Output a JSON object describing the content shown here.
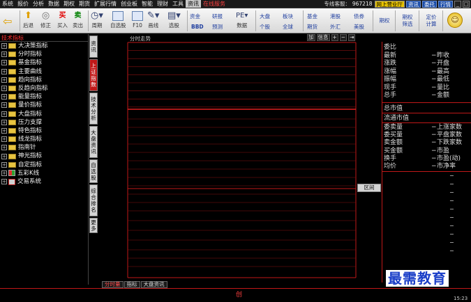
{
  "menubar": {
    "items": [
      "系统",
      "报价",
      "分析",
      "数据",
      "期权",
      "期货",
      "扩展行情",
      "创业板",
      "智能",
      "理财",
      "工具",
      "资讯",
      "在线服务"
    ],
    "hotline_label": "专线客服：",
    "hotline_number": "967218",
    "buttons": [
      "网上营业厅",
      "资讯",
      "委托",
      "行情"
    ]
  },
  "toolbar": {
    "back": "后退",
    "fav": "修正",
    "buy": "买入",
    "sell": "卖出",
    "period": "周期",
    "self_stock": "自选股",
    "f10": "F10",
    "draw": "画线",
    "select_stock": "选股",
    "capital": "资金",
    "bbd": "BBD",
    "research": "研报",
    "forecast": "预测",
    "data": "数据",
    "big_market": "大盘",
    "sector": "板块",
    "individual": "个股",
    "global": "全球",
    "fund": "基金",
    "futures": "期货",
    "hk": "港股",
    "forex": "外汇",
    "bond": "债券",
    "us": "美股",
    "options": "期权",
    "options_select": "期权\n筛选",
    "fixed_calc": "定价\n计算"
  },
  "tree": {
    "header": "技术指标",
    "items": [
      {
        "label": "大决策指标",
        "icon": "folder-icon"
      },
      {
        "label": "分时指标",
        "icon": "folder-icon"
      },
      {
        "label": "基金指标",
        "icon": "folder-icon"
      },
      {
        "label": "主要曲线",
        "icon": "folder-icon"
      },
      {
        "label": "趋向指标",
        "icon": "folder-icon"
      },
      {
        "label": "反趋向指标",
        "icon": "folder-icon"
      },
      {
        "label": "能量指标",
        "icon": "folder-icon"
      },
      {
        "label": "量价指标",
        "icon": "folder-icon"
      },
      {
        "label": "大盘指标",
        "icon": "folder-icon"
      },
      {
        "label": "压力支撑",
        "icon": "folder-icon"
      },
      {
        "label": "特色指标",
        "icon": "folder-icon"
      },
      {
        "label": "线龙指标",
        "icon": "folder-icon"
      },
      {
        "label": "指南针",
        "icon": "folder-icon"
      },
      {
        "label": "神光指标",
        "icon": "folder-icon"
      },
      {
        "label": "自定指标",
        "icon": "folder-icon"
      },
      {
        "label": "五彩K线",
        "icon": "colorful-k-icon"
      },
      {
        "label": "交易系统",
        "icon": "trade-system-icon"
      }
    ]
  },
  "vtabs": [
    "资讯",
    "上证指数",
    "技术分析",
    "大盘资讯",
    "自选股",
    "综合排名",
    "更多"
  ],
  "chart": {
    "title": "分时走势",
    "controls": [
      "加",
      "信息",
      "+",
      "−",
      "⇥"
    ],
    "range_button": "区间"
  },
  "quote": {
    "rows1": [
      [
        "委比",
        ""
      ],
      [
        "最新",
        "昨收"
      ],
      [
        "涨跌",
        "开盘"
      ],
      [
        "涨幅",
        "最高"
      ],
      [
        "振幅",
        "最低"
      ],
      [
        "现手",
        "量比"
      ],
      [
        "总手",
        "金额"
      ]
    ],
    "market_cap": "总市值",
    "float_cap": "流通市值",
    "rows2": [
      [
        "委卖量",
        "上涨家数"
      ],
      [
        "委买量",
        "平盘家数"
      ],
      [
        "卖金额",
        "下跌家数"
      ],
      [
        "买金额",
        "市盈"
      ],
      [
        "换手",
        "市盈(动)"
      ],
      [
        "均价",
        "市净率"
      ]
    ]
  },
  "bottom_tabs": [
    "分时量",
    "指标",
    "大盘资讯"
  ],
  "status": {
    "chuang": "创",
    "time": "15:23"
  },
  "watermark": "最需教育"
}
